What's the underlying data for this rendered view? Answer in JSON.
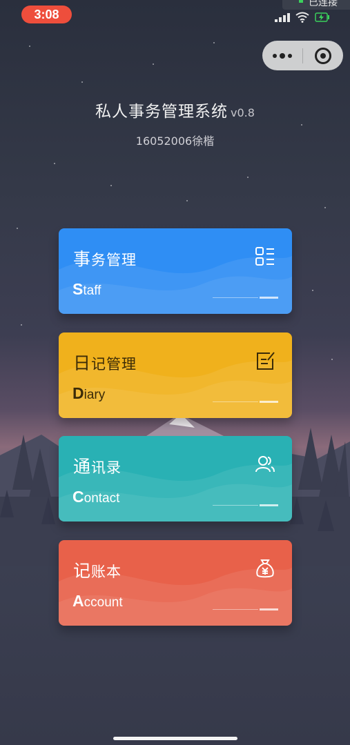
{
  "status": {
    "time": "3:08",
    "connection": "已连接"
  },
  "header": {
    "title": "私人事务管理系统",
    "version": "v0.8",
    "subtitle": "16052006徐楷"
  },
  "capsule": {
    "more_icon": "more-dots-icon",
    "close_icon": "target-close-icon"
  },
  "cards": [
    {
      "cn_first": "事",
      "cn_rest": "务管理",
      "en_first": "S",
      "en_rest": "taff",
      "icon": "list-icon",
      "color": "#2f8ef4"
    },
    {
      "cn_first": "日",
      "cn_rest": "记管理",
      "en_first": "D",
      "en_rest": "iary",
      "icon": "edit-note-icon",
      "color": "#f0b11c"
    },
    {
      "cn_first": "通",
      "cn_rest": "讯录",
      "en_first": "C",
      "en_rest": "ontact",
      "icon": "contacts-icon",
      "color": "#29b1b4"
    },
    {
      "cn_first": "记",
      "cn_rest": "账本",
      "en_first": "A",
      "en_rest": "ccount",
      "icon": "money-bag-icon",
      "color": "#e8614a"
    }
  ]
}
